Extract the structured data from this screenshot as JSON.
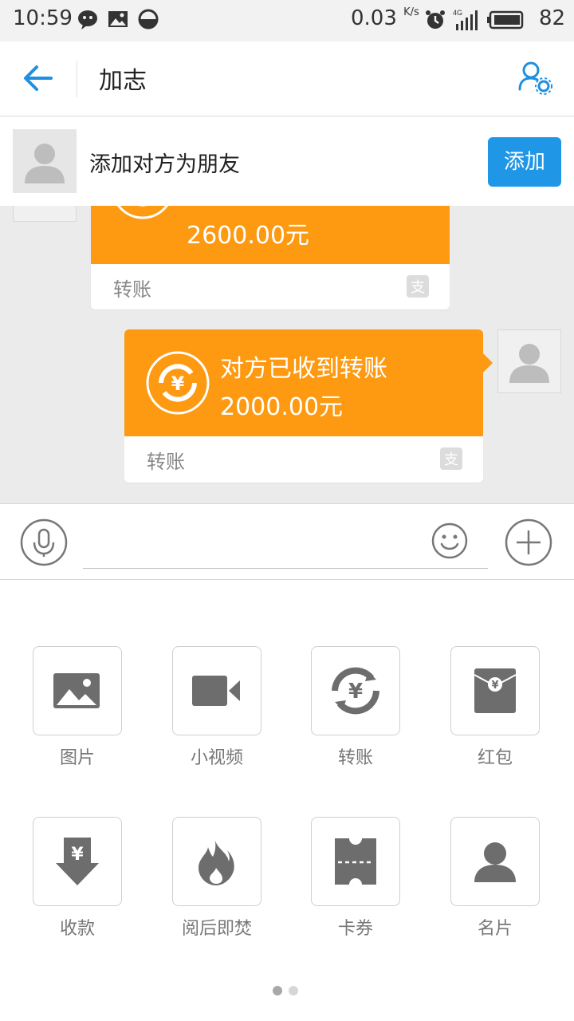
{
  "status_bar": {
    "time": "10:59",
    "net_speed": "0.03",
    "net_unit": "K/s",
    "network": "4G",
    "battery": "82"
  },
  "header": {
    "title": "加志"
  },
  "friend_bar": {
    "text": "添加对方为朋友",
    "add_label": "添加"
  },
  "messages": [
    {
      "title": "",
      "amount": "2600.00元",
      "footer": "转账"
    },
    {
      "title": "对方已收到转账",
      "amount": "2000.00元",
      "footer": "转账"
    }
  ],
  "input": {
    "placeholder": ""
  },
  "tools": [
    {
      "label": "图片",
      "icon": "image-icon"
    },
    {
      "label": "小视频",
      "icon": "video-icon"
    },
    {
      "label": "转账",
      "icon": "transfer-icon"
    },
    {
      "label": "红包",
      "icon": "red-envelope-icon"
    },
    {
      "label": "收款",
      "icon": "receive-money-icon"
    },
    {
      "label": "阅后即焚",
      "icon": "fire-icon"
    },
    {
      "label": "卡券",
      "icon": "coupon-icon"
    },
    {
      "label": "名片",
      "icon": "contact-card-icon"
    }
  ],
  "colors": {
    "accent": "#1f96e6",
    "transfer_orange": "#fd9a12"
  },
  "pager": {
    "pages": 2,
    "current": 1
  }
}
